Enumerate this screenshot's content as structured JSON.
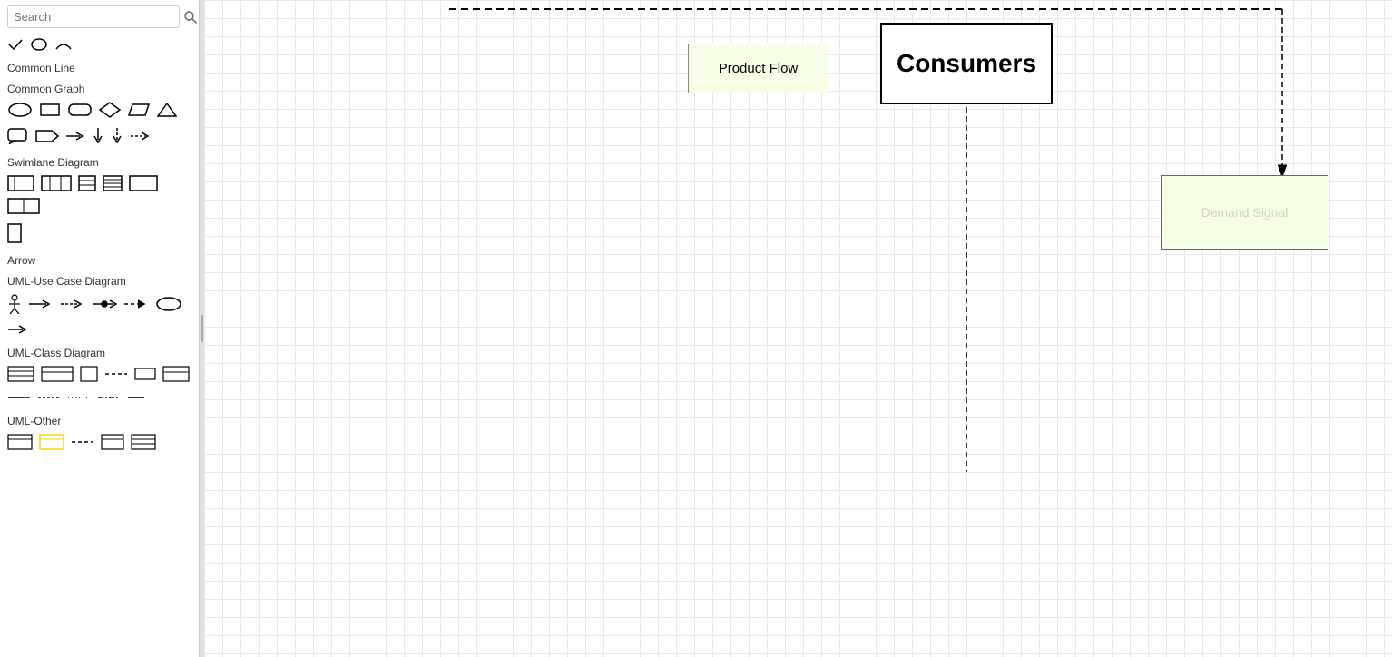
{
  "sidebar": {
    "search_placeholder": "Search",
    "sections": [
      {
        "id": "common-line",
        "label": "Common Line"
      },
      {
        "id": "common-graph",
        "label": "Common Graph"
      },
      {
        "id": "swimlane-diagram",
        "label": "Swimlane Diagram"
      },
      {
        "id": "arrow",
        "label": "Arrow"
      },
      {
        "id": "uml-use-case",
        "label": "UML-Use Case Diagram"
      },
      {
        "id": "uml-class",
        "label": "UML-Class Diagram"
      },
      {
        "id": "uml-other",
        "label": "UML-Other"
      }
    ]
  },
  "canvas": {
    "nodes": {
      "consumers": {
        "label": "Consumers"
      },
      "product_flow": {
        "label": "Product Flow"
      },
      "demand_signal": {
        "label": "Demand Signal"
      }
    }
  }
}
